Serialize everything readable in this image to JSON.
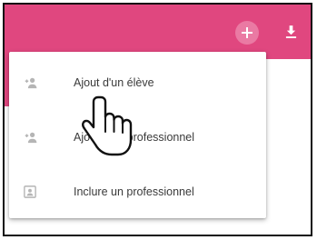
{
  "colors": {
    "accent": "#e0477f",
    "add_button": "#ea7aa3"
  },
  "toolbar": {
    "add_button_icon": "plus-icon",
    "download_button_icon": "download-icon"
  },
  "menu": {
    "items": [
      {
        "label": "Ajout d'un élève",
        "icon": "add-person-icon"
      },
      {
        "label": "Ajout d'un professionnel",
        "icon": "add-person-icon"
      },
      {
        "label": "Inclure un professionnel",
        "icon": "contact-card-icon"
      }
    ]
  }
}
